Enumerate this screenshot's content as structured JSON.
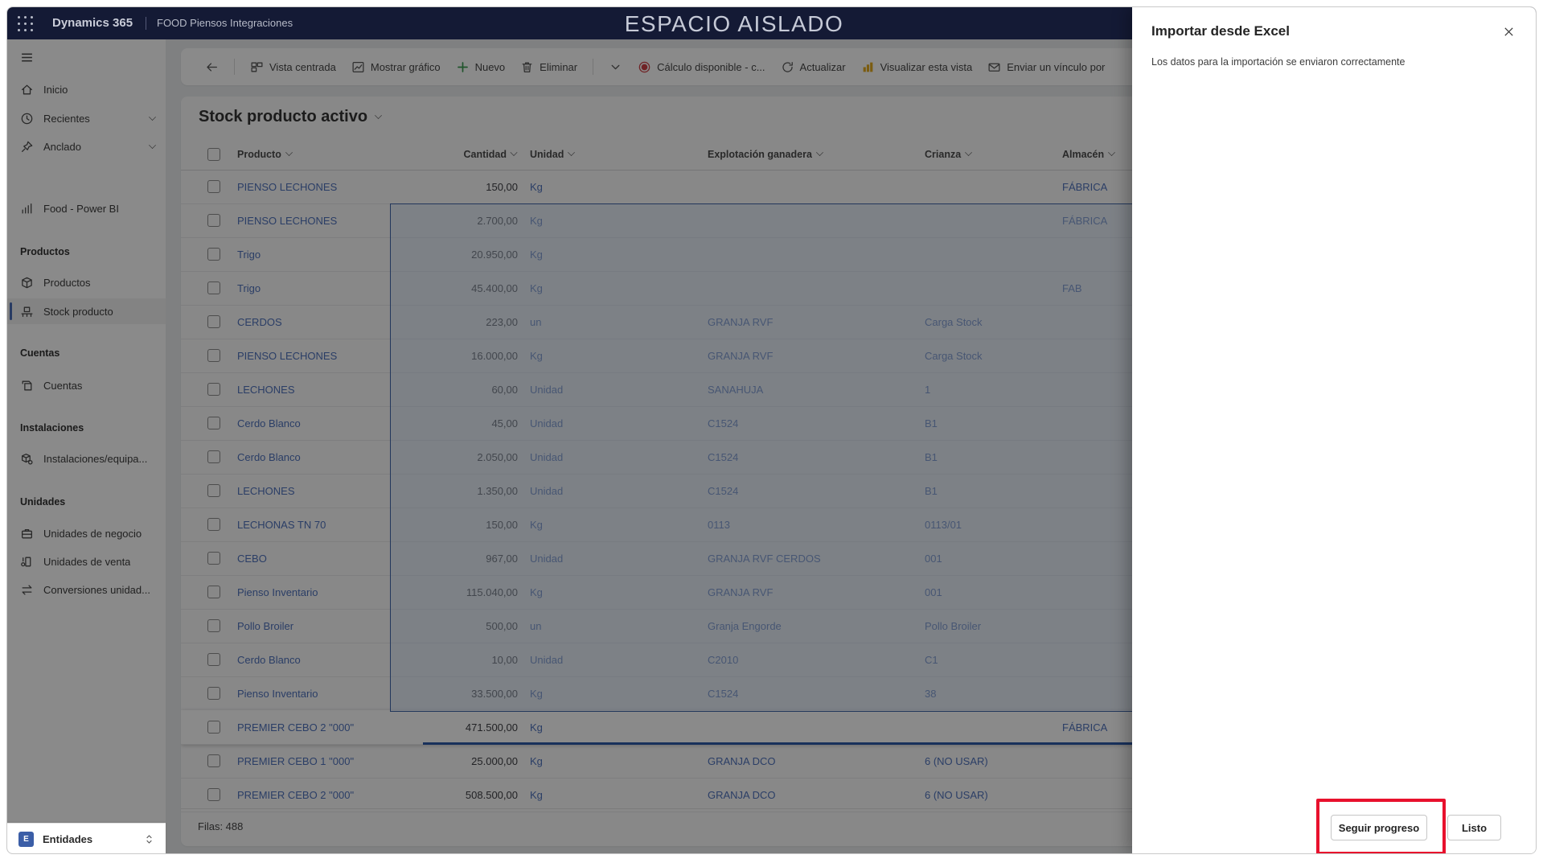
{
  "topbar": {
    "brand": "Dynamics 365",
    "app_name": "FOOD Piensos Integraciones",
    "environment_banner": "ESPACIO AISLADO"
  },
  "sidebar": {
    "items": [
      {
        "type": "item",
        "icon": "home-icon",
        "label": "Inicio"
      },
      {
        "type": "item",
        "icon": "clock-icon",
        "label": "Recientes",
        "chevron": true
      },
      {
        "type": "item",
        "icon": "pin-icon",
        "label": "Anclado",
        "chevron": true
      },
      {
        "type": "item",
        "icon": "powerbi-icon",
        "label": "Food - Power BI"
      },
      {
        "type": "group",
        "label": "Productos"
      },
      {
        "type": "item",
        "icon": "cube-icon",
        "label": "Productos"
      },
      {
        "type": "item",
        "icon": "stock-icon",
        "label": "Stock producto",
        "selected": true
      },
      {
        "type": "group",
        "label": "Cuentas"
      },
      {
        "type": "item",
        "icon": "accounts-icon",
        "label": "Cuentas"
      },
      {
        "type": "group",
        "label": "Instalaciones"
      },
      {
        "type": "item",
        "icon": "equipment-icon",
        "label": "Instalaciones/equipa..."
      },
      {
        "type": "group",
        "label": "Unidades"
      },
      {
        "type": "item",
        "icon": "briefcase-icon",
        "label": "Unidades de negocio"
      },
      {
        "type": "item",
        "icon": "sales-unit-icon",
        "label": "Unidades de venta"
      },
      {
        "type": "item",
        "icon": "convert-icon",
        "label": "Conversiones unidad..."
      }
    ],
    "entity_switcher": {
      "initial": "E",
      "label": "Entidades"
    }
  },
  "command_bar": {
    "items": [
      {
        "type": "button",
        "icon": "back-arrow-icon"
      },
      {
        "type": "divider"
      },
      {
        "type": "button",
        "icon": "grid-view-icon",
        "label": "Vista centrada"
      },
      {
        "type": "button",
        "icon": "show-chart-icon",
        "label": "Mostrar gráfico"
      },
      {
        "type": "button",
        "icon": "plus-icon",
        "label": "Nuevo",
        "icon_color": "#3c9b52"
      },
      {
        "type": "button",
        "icon": "trash-icon",
        "label": "Eliminar"
      },
      {
        "type": "divider"
      },
      {
        "type": "button",
        "icon": "chevron-down-icon"
      },
      {
        "type": "button",
        "icon": "record-dot-icon",
        "label": "Cálculo disponible - c...",
        "icon_color": "#cf4147"
      },
      {
        "type": "button",
        "icon": "refresh-icon",
        "label": "Actualizar"
      },
      {
        "type": "button",
        "icon": "powerbi-bars-icon",
        "label": "Visualizar esta vista",
        "icon_color": "#e3aa1f"
      },
      {
        "type": "button",
        "icon": "email-link-icon",
        "label": "Enviar un vínculo por"
      }
    ]
  },
  "grid": {
    "view_title": "Stock producto activo",
    "columns": [
      "Producto",
      "Cantidad",
      "Unidad",
      "Explotación ganadera",
      "Crianza",
      "Almacén"
    ],
    "rows": [
      {
        "producto": "PIENSO LECHONES",
        "cantidad": "150,00",
        "unidad": "Kg",
        "explotacion": "",
        "crianza": "",
        "almacen": "FÁBRICA"
      },
      {
        "producto": "PIENSO LECHONES",
        "cantidad": "2.700,00",
        "unidad": "Kg",
        "explotacion": "",
        "crianza": "",
        "almacen": "FÁBRICA"
      },
      {
        "producto": "Trigo",
        "cantidad": "20.950,00",
        "unidad": "Kg",
        "explotacion": "",
        "crianza": "",
        "almacen": ""
      },
      {
        "producto": "Trigo",
        "cantidad": "45.400,00",
        "unidad": "Kg",
        "explotacion": "",
        "crianza": "",
        "almacen": "FAB"
      },
      {
        "producto": "CERDOS",
        "cantidad": "223,00",
        "unidad": "un",
        "explotacion": "GRANJA RVF",
        "crianza": "Carga Stock",
        "almacen": ""
      },
      {
        "producto": "PIENSO LECHONES",
        "cantidad": "16.000,00",
        "unidad": "Kg",
        "explotacion": "GRANJA RVF",
        "crianza": "Carga Stock",
        "almacen": ""
      },
      {
        "producto": "LECHONES",
        "cantidad": "60,00",
        "unidad": "Unidad",
        "explotacion": "SANAHUJA",
        "crianza": "1",
        "almacen": ""
      },
      {
        "producto": "Cerdo Blanco",
        "cantidad": "45,00",
        "unidad": "Unidad",
        "explotacion": "C1524",
        "crianza": "B1",
        "almacen": ""
      },
      {
        "producto": "Cerdo Blanco",
        "cantidad": "2.050,00",
        "unidad": "Unidad",
        "explotacion": "C1524",
        "crianza": "B1",
        "almacen": ""
      },
      {
        "producto": "LECHONES",
        "cantidad": "1.350,00",
        "unidad": "Unidad",
        "explotacion": "C1524",
        "crianza": "B1",
        "almacen": ""
      },
      {
        "producto": "LECHONAS TN 70",
        "cantidad": "150,00",
        "unidad": "Kg",
        "explotacion": "0113",
        "crianza": "0113/01",
        "almacen": ""
      },
      {
        "producto": "CEBO",
        "cantidad": "967,00",
        "unidad": "Unidad",
        "explotacion": "GRANJA RVF CERDOS",
        "crianza": "001",
        "almacen": ""
      },
      {
        "producto": "Pienso Inventario",
        "cantidad": "115.040,00",
        "unidad": "Kg",
        "explotacion": "GRANJA RVF",
        "crianza": "001",
        "almacen": ""
      },
      {
        "producto": "Pollo Broiler",
        "cantidad": "500,00",
        "unidad": "un",
        "explotacion": "Granja Engorde",
        "crianza": "Pollo Broiler",
        "almacen": ""
      },
      {
        "producto": "Cerdo Blanco",
        "cantidad": "10,00",
        "unidad": "Unidad",
        "explotacion": "C2010",
        "crianza": "C1",
        "almacen": ""
      },
      {
        "producto": "Pienso Inventario",
        "cantidad": "33.500,00",
        "unidad": "Kg",
        "explotacion": "C1524",
        "crianza": "38",
        "almacen": ""
      },
      {
        "producto": "PREMIER CEBO 2 \"000\"",
        "cantidad": "471.500,00",
        "unidad": "Kg",
        "explotacion": "",
        "crianza": "",
        "almacen": "FÁBRICA",
        "focused": true
      },
      {
        "producto": "PREMIER CEBO 1 \"000\"",
        "cantidad": "25.000,00",
        "unidad": "Kg",
        "explotacion": "GRANJA DCO",
        "crianza": "6 (NO USAR)",
        "almacen": ""
      },
      {
        "producto": "PREMIER CEBO 2 \"000\"",
        "cantidad": "508.500,00",
        "unidad": "Kg",
        "explotacion": "GRANJA DCO",
        "crianza": "6 (NO USAR)",
        "almacen": ""
      }
    ],
    "selection_block": {
      "first_row": 2,
      "last_row": 16
    },
    "footer": "Filas: 488"
  },
  "panel": {
    "title": "Importar desde Excel",
    "message": "Los datos para la importación se enviaron correctamente",
    "buttons": [
      {
        "label": "Seguir progreso",
        "highlighted": true
      },
      {
        "label": "Listo"
      }
    ]
  }
}
